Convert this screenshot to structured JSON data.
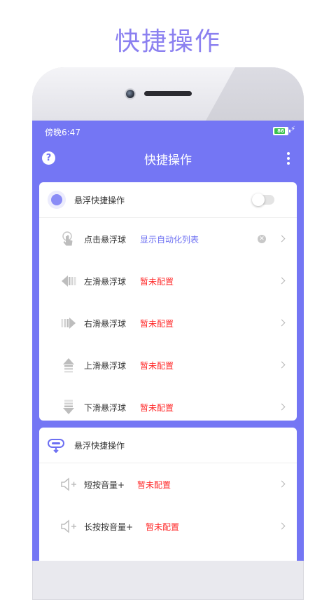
{
  "promo": {
    "title": "快捷操作"
  },
  "status_bar": {
    "time": "傍晚6:47",
    "battery_level": "86",
    "battery_fraction": 0.86
  },
  "app_bar": {
    "title": "快捷操作",
    "help_label": "?"
  },
  "card1": {
    "header": {
      "title": "悬浮快捷操作",
      "toggle_on": false
    },
    "rows": [
      {
        "label": "点击悬浮球",
        "value": "显示自动化列表",
        "status": "set",
        "icon": "tap-icon"
      },
      {
        "label": "左滑悬浮球",
        "value": "暂未配置",
        "status": "unset",
        "icon": "swipe-left-icon"
      },
      {
        "label": "右滑悬浮球",
        "value": "暂未配置",
        "status": "unset",
        "icon": "swipe-right-icon"
      },
      {
        "label": "上滑悬浮球",
        "value": "暂未配置",
        "status": "unset",
        "icon": "swipe-up-icon"
      },
      {
        "label": "下滑悬浮球",
        "value": "暂未配置",
        "status": "unset",
        "icon": "swipe-down-icon"
      }
    ]
  },
  "card2": {
    "header": {
      "title": "悬浮快捷操作"
    },
    "rows": [
      {
        "label": "短按音量+",
        "value": "暂未配置",
        "status": "unset",
        "icon": "volume-up-icon"
      },
      {
        "label": "长按按音量+",
        "value": "暂未配置",
        "status": "unset",
        "icon": "volume-up-icon"
      }
    ]
  },
  "colors": {
    "accent": "#7476f4",
    "promo": "#8b80f0",
    "set_value": "#6c6ff2",
    "unset_value": "#ff2b2b"
  }
}
